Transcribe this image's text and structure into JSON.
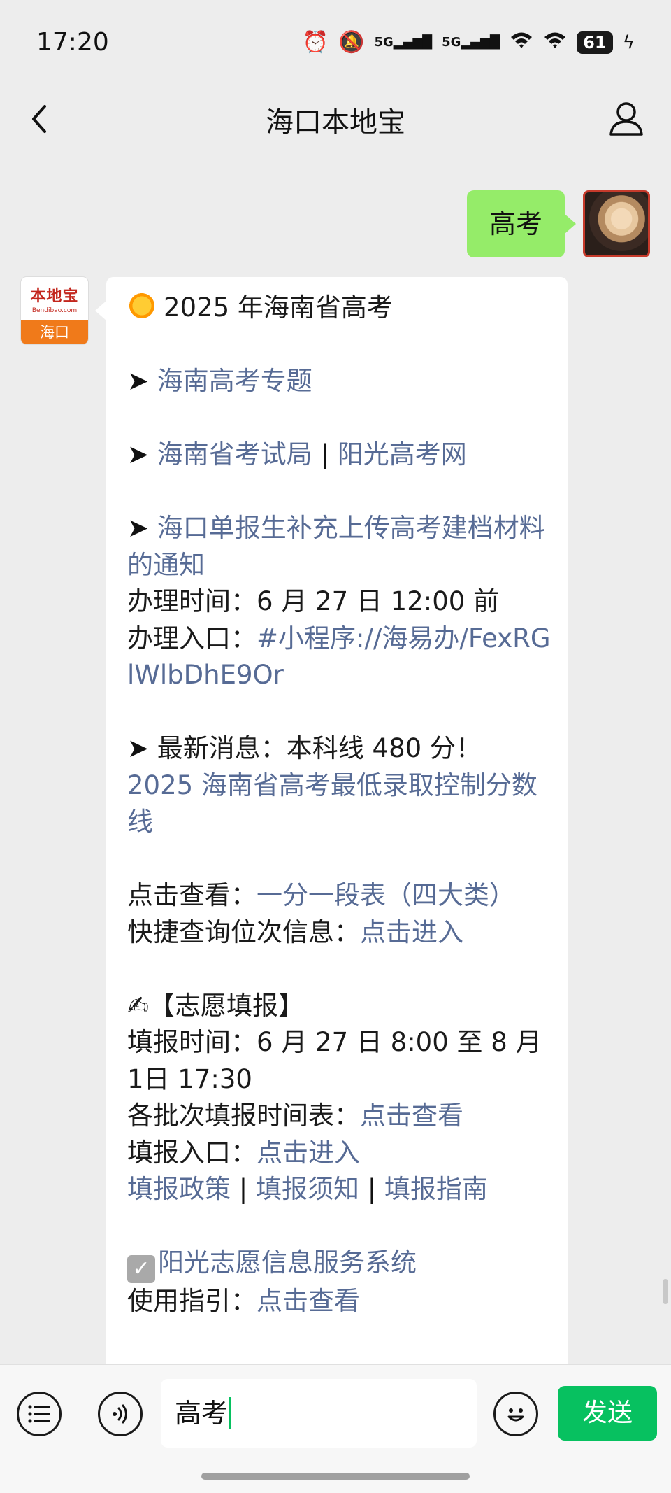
{
  "status_bar": {
    "time": "17:20",
    "signal_1": "5G",
    "signal_2": "5G",
    "battery": "61",
    "icons": [
      "alarm-icon",
      "mute-icon",
      "signal-icon",
      "signal-icon",
      "wifi-icon",
      "wifi-icon",
      "battery-icon",
      "charging-icon"
    ]
  },
  "nav": {
    "title": "海口本地宝",
    "back_icon": "back-icon",
    "profile_icon": "person-icon"
  },
  "chat": {
    "my_message": "高考",
    "bot_avatar": {
      "brand": "本地宝",
      "domain": "Bendibao.com",
      "city": "海口"
    },
    "reply": {
      "title": "2025 年海南省高考",
      "link_topic": "海南高考专题",
      "link_exam_bureau": "海南省考试局",
      "link_sunshine": "阳光高考网",
      "separator": "|",
      "link_notice": "海口单报生补充上传高考建档材料的通知",
      "handle_time_label": "办理时间：",
      "handle_time_value": "6 月 27 日 12:00 前",
      "handle_entry_label": "办理入口：",
      "handle_entry_link": "#小程序://海易办/FexRGlWlbDhE9Or",
      "latest_label": "最新消息：本科线 480 分！",
      "latest_link": "2025 海南省高考最低录取控制分数线",
      "check_label": "点击查看：",
      "check_link": "一分一段表（四大类）",
      "rank_label": "快捷查询位次信息：",
      "rank_link": "点击进入",
      "wish_title": "【志愿填报】",
      "fill_time_label": "填报时间：",
      "fill_time_value": "6 月 27 日 8:00 至 8 月 1日 17:30",
      "batch_label": "各批次填报时间表：",
      "batch_link": "点击查看",
      "fill_entry_label": "填报入口：",
      "fill_entry_link": "点击进入",
      "policy_link": "填报政策",
      "notice_link": "填报须知",
      "guide_link": "填报指南",
      "system_link": "阳光志愿信息服务系统",
      "usage_label": "使用指引：",
      "usage_link": "点击查看"
    }
  },
  "input_bar": {
    "value": "高考",
    "send_label": "发送",
    "icons": [
      "menu-icon",
      "voice-icon",
      "emoji-icon"
    ]
  }
}
